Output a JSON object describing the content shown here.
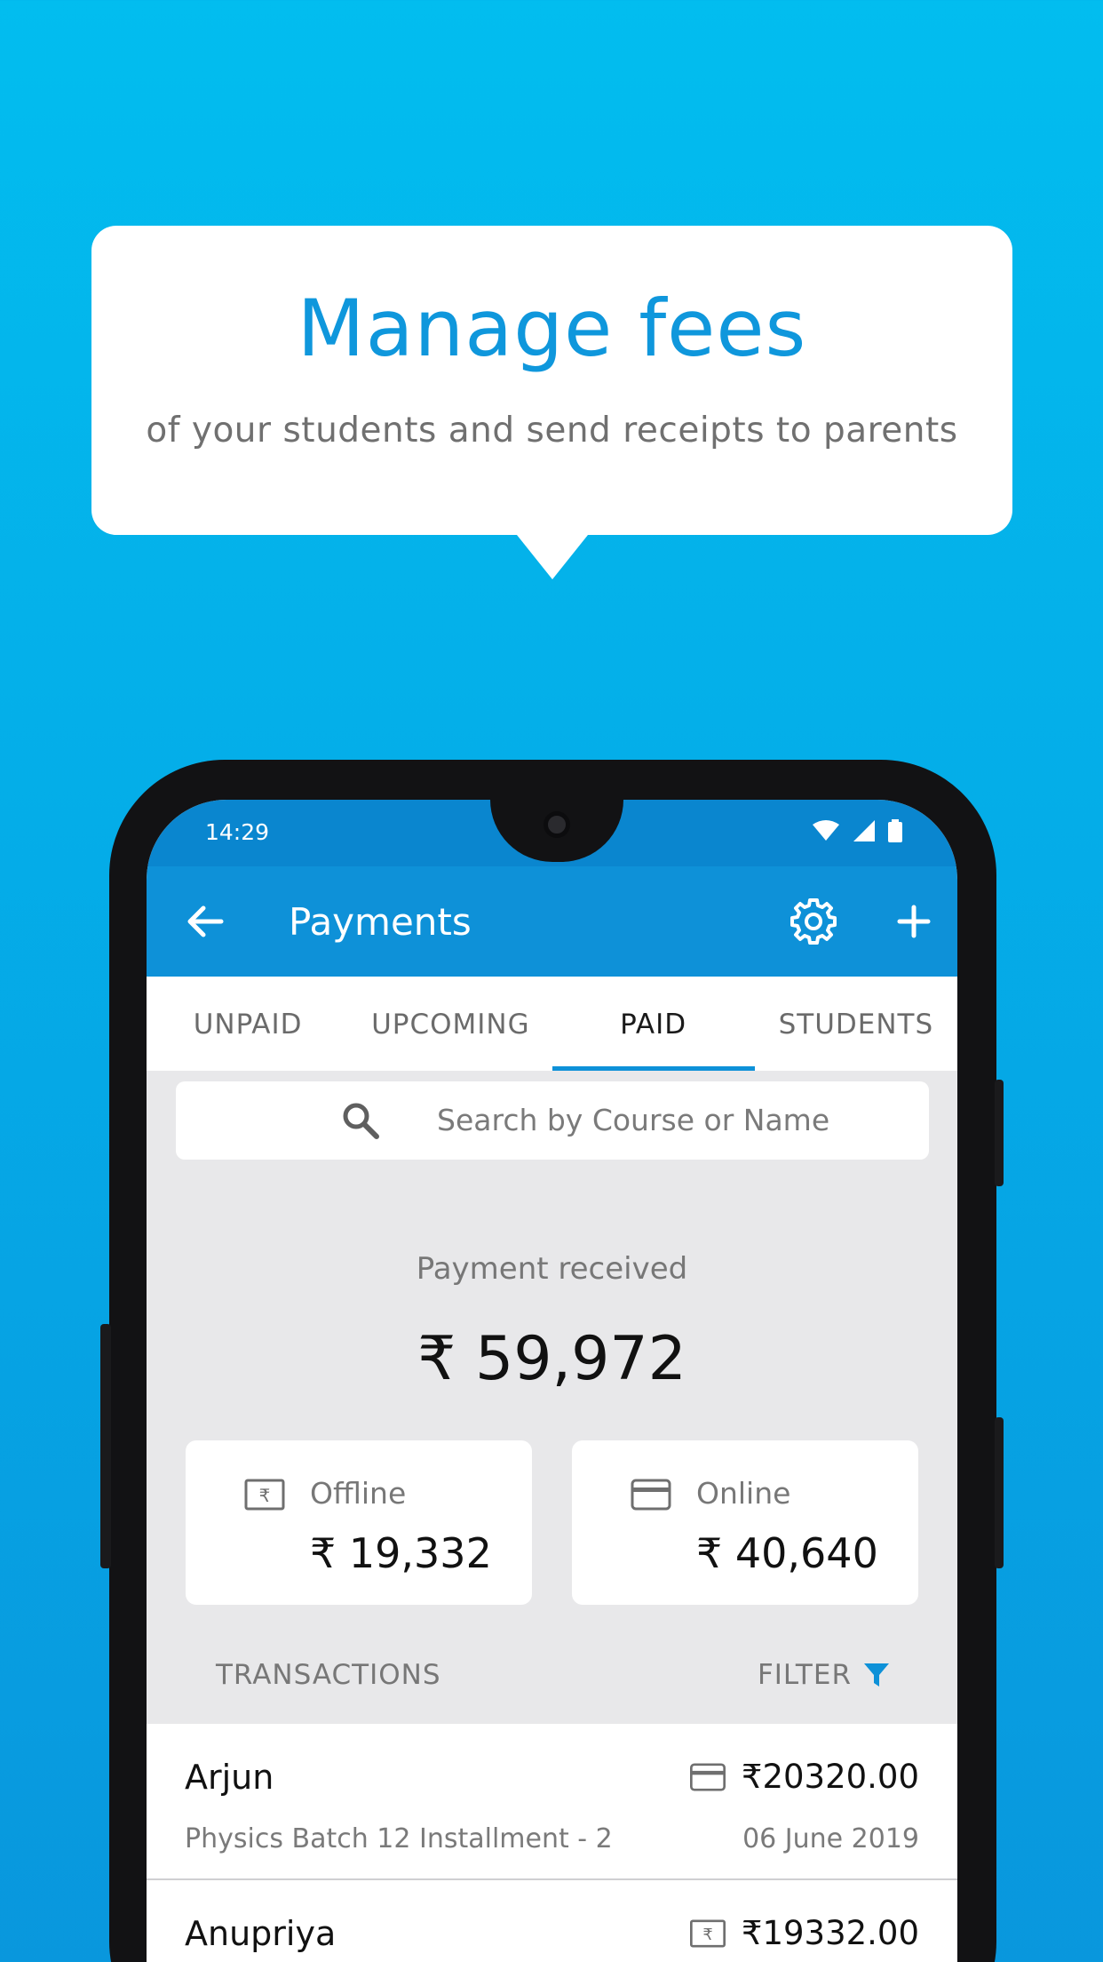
{
  "promo": {
    "title": "Manage fees",
    "subtitle": "of your students and send receipts to parents"
  },
  "status_bar": {
    "time": "14:29"
  },
  "app_bar": {
    "title": "Payments"
  },
  "tabs": [
    {
      "label": "UNPAID",
      "active": false
    },
    {
      "label": "UPCOMING",
      "active": false
    },
    {
      "label": "PAID",
      "active": true
    },
    {
      "label": "STUDENTS",
      "active": false
    }
  ],
  "search": {
    "placeholder": "Search by Course or Name"
  },
  "summary": {
    "label": "Payment received",
    "amount": "₹ 59,972",
    "offline": {
      "label": "Offline",
      "amount": "₹ 19,332",
      "icon": "rupee-note-icon"
    },
    "online": {
      "label": "Online",
      "amount": "₹ 40,640",
      "icon": "credit-card-icon"
    }
  },
  "transactions": {
    "header": "TRANSACTIONS",
    "filter_label": "FILTER",
    "items": [
      {
        "name": "Arjun",
        "amount": "₹20320.00",
        "description": "Physics Batch 12 Installment - 2",
        "date": "06 June 2019",
        "icon": "credit-card-icon"
      },
      {
        "name": "Anupriya",
        "amount": "₹19332.00",
        "description": "",
        "date": "",
        "icon": "rupee-note-icon"
      }
    ]
  },
  "colors": {
    "background_top": "#02bdef",
    "app_bar": "#0e91d8",
    "status_bar": "#0a86cf",
    "accent": "#0e91d8",
    "title_blue": "#0f97dc"
  }
}
